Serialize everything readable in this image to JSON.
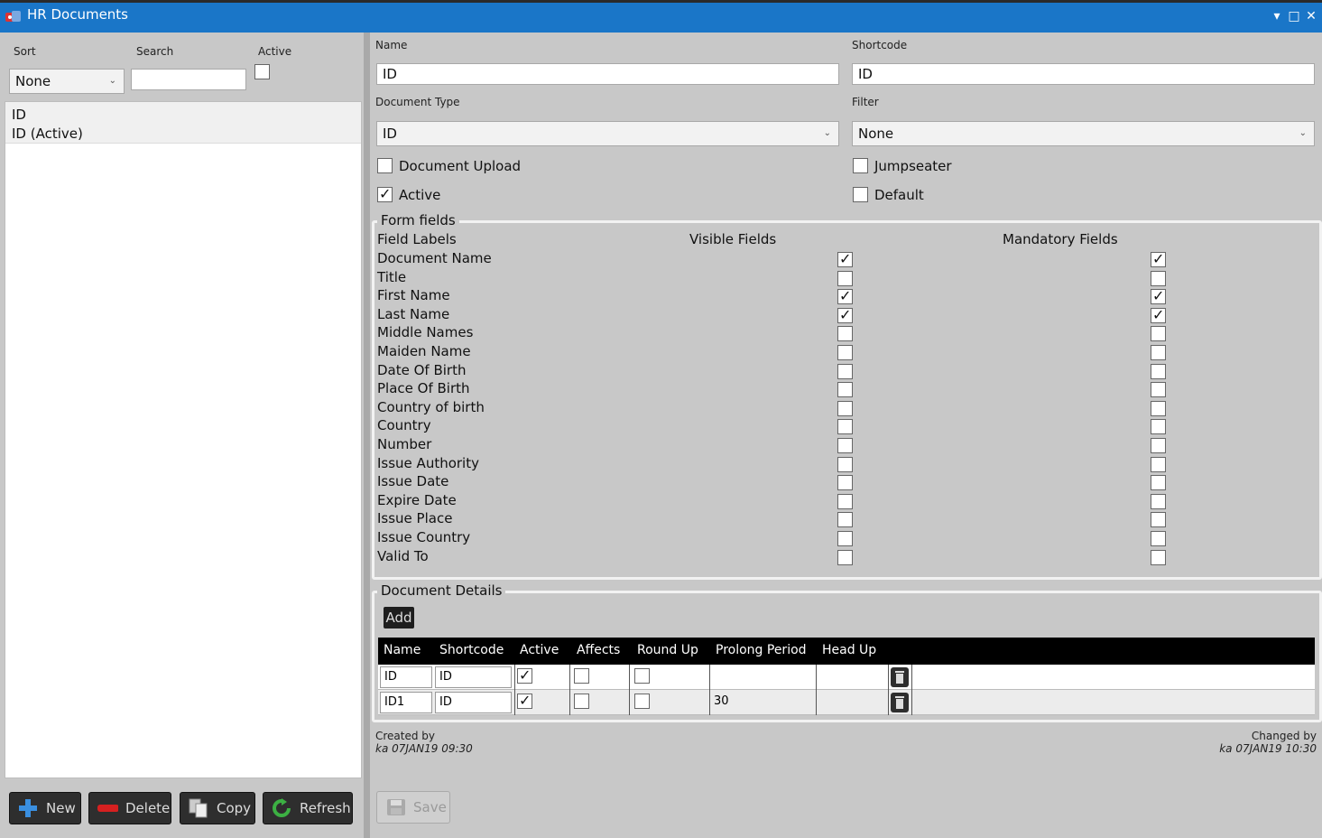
{
  "window": {
    "title": "HR Documents",
    "controls": [
      "chevron-down-icon",
      "maximize-icon",
      "close-icon"
    ]
  },
  "left": {
    "sort_label": "Sort",
    "search_label": "Search",
    "active_label": "Active",
    "sort_value": "None",
    "search_value": "",
    "active_checked": false,
    "items": [
      {
        "line1": "ID",
        "line2": "ID (Active)"
      }
    ],
    "buttons": {
      "new": "New",
      "delete": "Delete",
      "copy": "Copy",
      "refresh": "Refresh"
    }
  },
  "form": {
    "name_label": "Name",
    "name_value": "ID",
    "shortcode_label": "Shortcode",
    "shortcode_value": "ID",
    "doctype_label": "Document Type",
    "doctype_value": "ID",
    "filter_label": "Filter",
    "filter_value": "None",
    "document_upload_label": "Document Upload",
    "document_upload_checked": false,
    "jumpseater_label": "Jumpseater",
    "jumpseater_checked": false,
    "active_label": "Active",
    "active_checked": true,
    "default_label": "Default",
    "default_checked": false
  },
  "form_fields": {
    "title": "Form fields",
    "col_labels": "Field Labels",
    "col_visible": "Visible Fields",
    "col_mandatory": "Mandatory Fields",
    "rows": [
      {
        "label": "Document Name",
        "visible": true,
        "mandatory": true
      },
      {
        "label": "Title",
        "visible": false,
        "mandatory": false
      },
      {
        "label": "First Name",
        "visible": true,
        "mandatory": true
      },
      {
        "label": "Last Name",
        "visible": true,
        "mandatory": true
      },
      {
        "label": "Middle Names",
        "visible": false,
        "mandatory": false
      },
      {
        "label": "Maiden Name",
        "visible": false,
        "mandatory": false
      },
      {
        "label": "Date Of Birth",
        "visible": false,
        "mandatory": false
      },
      {
        "label": "Place Of Birth",
        "visible": false,
        "mandatory": false
      },
      {
        "label": "Country of birth",
        "visible": false,
        "mandatory": false
      },
      {
        "label": "Country",
        "visible": false,
        "mandatory": false
      },
      {
        "label": "Number",
        "visible": false,
        "mandatory": false
      },
      {
        "label": "Issue Authority",
        "visible": false,
        "mandatory": false
      },
      {
        "label": "Issue Date",
        "visible": false,
        "mandatory": false
      },
      {
        "label": "Expire Date",
        "visible": false,
        "mandatory": false
      },
      {
        "label": "Issue Place",
        "visible": false,
        "mandatory": false
      },
      {
        "label": "Issue Country",
        "visible": false,
        "mandatory": false
      },
      {
        "label": "Valid To",
        "visible": false,
        "mandatory": false
      }
    ]
  },
  "details": {
    "title": "Document Details",
    "add_label": "Add",
    "columns": [
      "Name",
      "Shortcode",
      "Active",
      "Affects",
      "Round Up",
      "Prolong Period",
      "Head Up"
    ],
    "rows": [
      {
        "name": "ID",
        "shortcode": "ID",
        "active": true,
        "affects": false,
        "round_up": false,
        "prolong": "",
        "head_up": ""
      },
      {
        "name": "ID1",
        "shortcode": "ID",
        "active": true,
        "affects": false,
        "round_up": false,
        "prolong": "30",
        "head_up": ""
      }
    ]
  },
  "footer": {
    "created_label": "Created by",
    "created_value": "ka  07JAN19 09:30",
    "changed_label": "Changed by",
    "changed_value": "ka  07JAN19 10:30",
    "save_label": "Save"
  }
}
